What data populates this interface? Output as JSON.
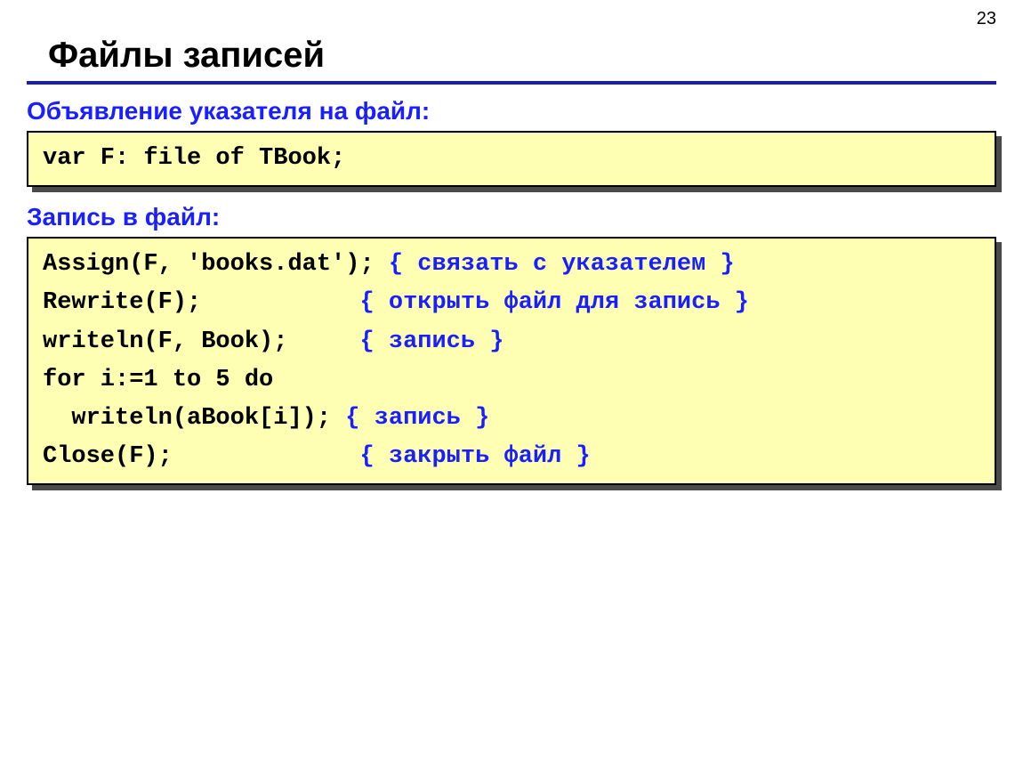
{
  "page_number": "23",
  "title": "Файлы записей",
  "section1_label": "Объявление указателя на файл:",
  "code1": {
    "line1": "var F: file of TBook;"
  },
  "section2_label": "Запись в файл:",
  "code2": {
    "l1a": "Assign(F, 'books.dat'); ",
    "l1b": "{ связать с указателем }",
    "l2a": "Rewrite(F);           ",
    "l2b": "{ открыть файл для запись }",
    "l3a": "writeln(F, Book);     ",
    "l3b": "{ запись }",
    "l4a": "for i:=1 to 5 do",
    "l5a": "  writeln(aBook[i]); ",
    "l5b": "{ запись }",
    "l6a": "Close(F);             ",
    "l6b": "{ закрыть файл }"
  }
}
